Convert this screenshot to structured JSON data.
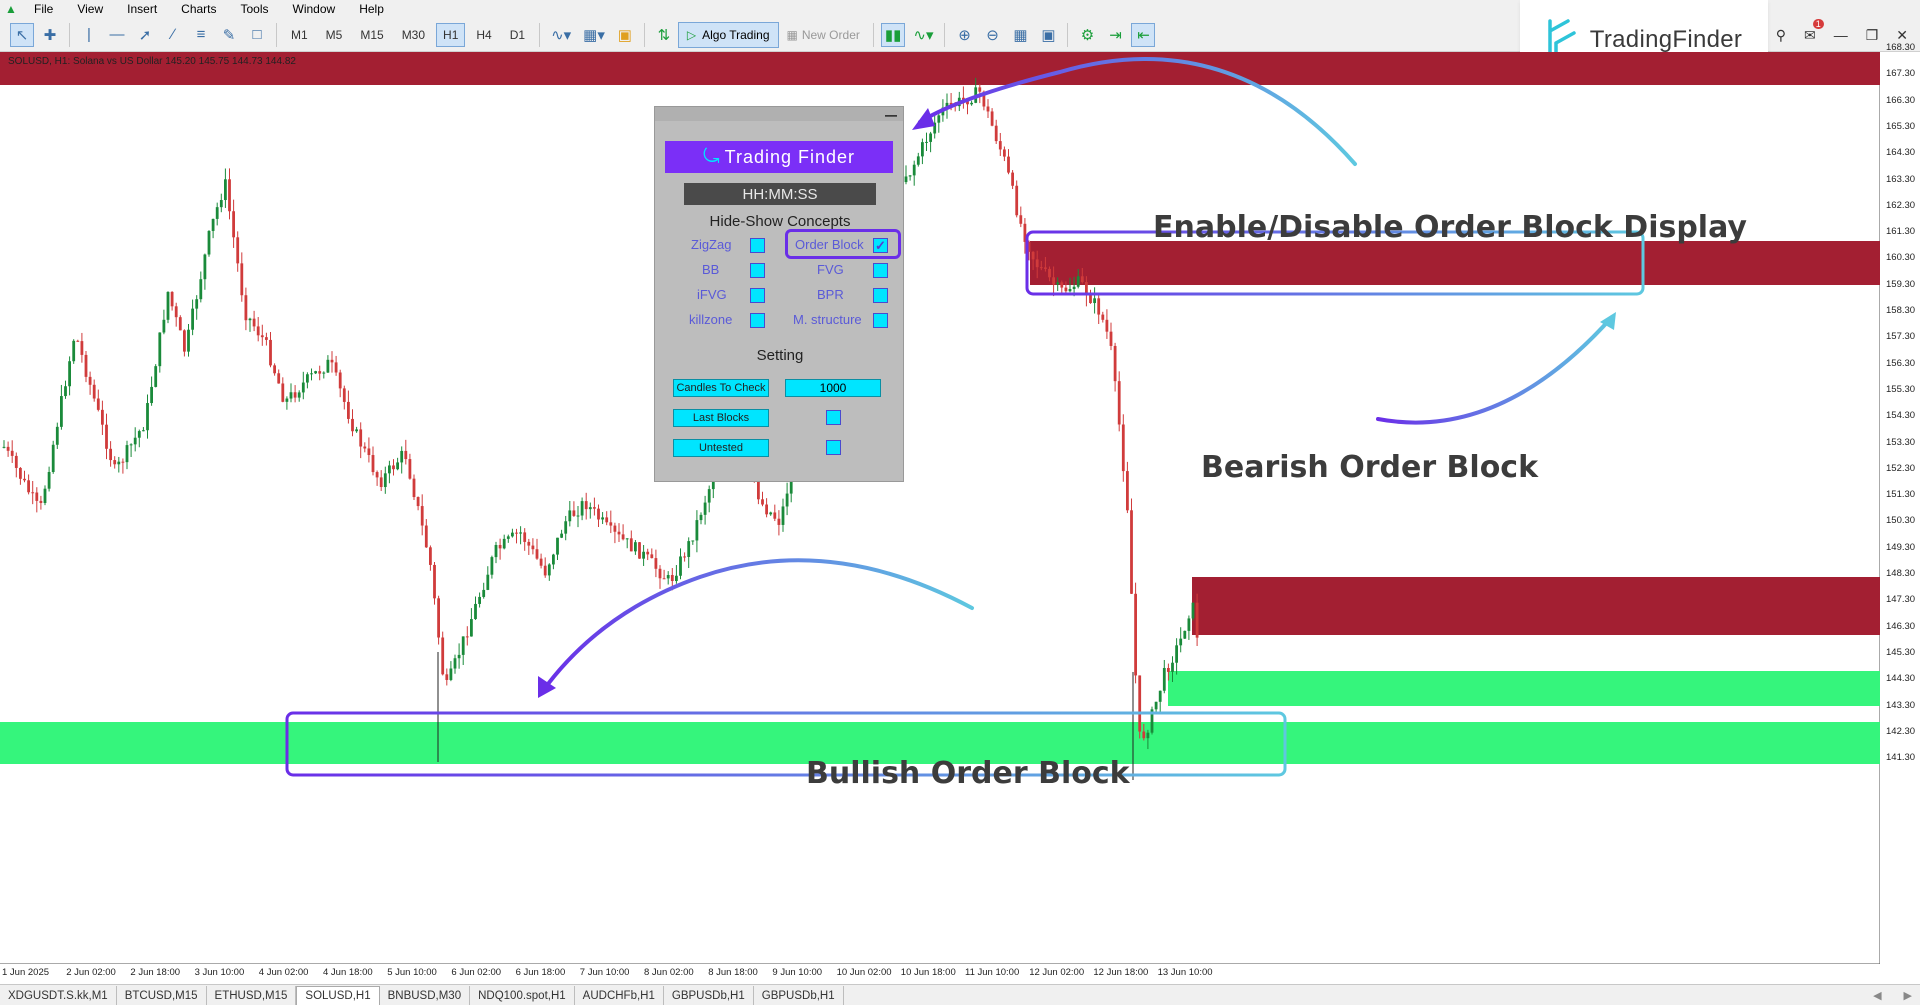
{
  "menu": {
    "items": [
      "File",
      "View",
      "Insert",
      "Charts",
      "Tools",
      "Window",
      "Help"
    ]
  },
  "toolbar": {
    "timeframes": [
      "M1",
      "M5",
      "M15",
      "M30",
      "H1",
      "H4",
      "D1"
    ],
    "active_timeframe": "H1",
    "algo_label": "Algo Trading",
    "new_order_label": "New Order"
  },
  "brand": {
    "name": "TradingFinder",
    "notification_count": "1"
  },
  "chart": {
    "info": "SOLUSD, H1:  Solana vs US Dollar  145.20 145.75 144.73 144.82",
    "price_ticks": [
      "168.30",
      "167.30",
      "166.30",
      "165.30",
      "164.30",
      "163.30",
      "162.30",
      "161.30",
      "160.30",
      "159.30",
      "158.30",
      "157.30",
      "156.30",
      "155.30",
      "154.30",
      "153.30",
      "152.30",
      "151.30",
      "150.30",
      "149.30",
      "148.30",
      "147.30",
      "146.30",
      "145.30",
      "144.30",
      "143.30",
      "142.30",
      "141.30"
    ],
    "time_ticks": [
      "1 Jun 2025",
      "2 Jun 02:00",
      "2 Jun 18:00",
      "3 Jun 10:00",
      "4 Jun 02:00",
      "4 Jun 18:00",
      "5 Jun 10:00",
      "6 Jun 02:00",
      "6 Jun 18:00",
      "7 Jun 10:00",
      "8 Jun 02:00",
      "8 Jun 18:00",
      "9 Jun 10:00",
      "10 Jun 02:00",
      "10 Jun 18:00",
      "11 Jun 10:00",
      "12 Jun 02:00",
      "12 Jun 18:00",
      "13 Jun 10:00"
    ],
    "colors": {
      "bull": "#1a8a3a",
      "bear": "#d03b3b",
      "bearish_block": "#a31f32",
      "bullish_block": "#35f57c"
    }
  },
  "panel": {
    "title": "Trading Finder",
    "clock": "HH:MM:SS",
    "concepts_heading": "Hide-Show Concepts",
    "concepts": [
      {
        "label": "ZigZag",
        "checked": false
      },
      {
        "label": "Order Block",
        "checked": true
      },
      {
        "label": "BB",
        "checked": false
      },
      {
        "label": "FVG",
        "checked": false
      },
      {
        "label": "iFVG",
        "checked": false
      },
      {
        "label": "BPR",
        "checked": false
      },
      {
        "label": "killzone",
        "checked": false
      },
      {
        "label": "M. structure",
        "checked": false
      }
    ],
    "setting_heading": "Setting",
    "candles_label": "Candles To Check",
    "candles_value": "1000",
    "last_blocks_label": "Last Blocks",
    "untested_label": "Untested"
  },
  "annotations": {
    "toggle": "Enable/Disable Order Block Display",
    "bearish": "Bearish Order Block",
    "bullish": "Bullish Order Block"
  },
  "tabs": {
    "items": [
      "XDGUSDT.S.kk,M1",
      "BTCUSD,M15",
      "ETHUSD,M15",
      "SOLUSD,H1",
      "BNBUSD,M30",
      "NDQ100.spot,H1",
      "AUDCHFb,H1",
      "GBPUSDb,H1",
      "GBPUSDb,H1"
    ],
    "active": "SOLUSD,H1"
  }
}
